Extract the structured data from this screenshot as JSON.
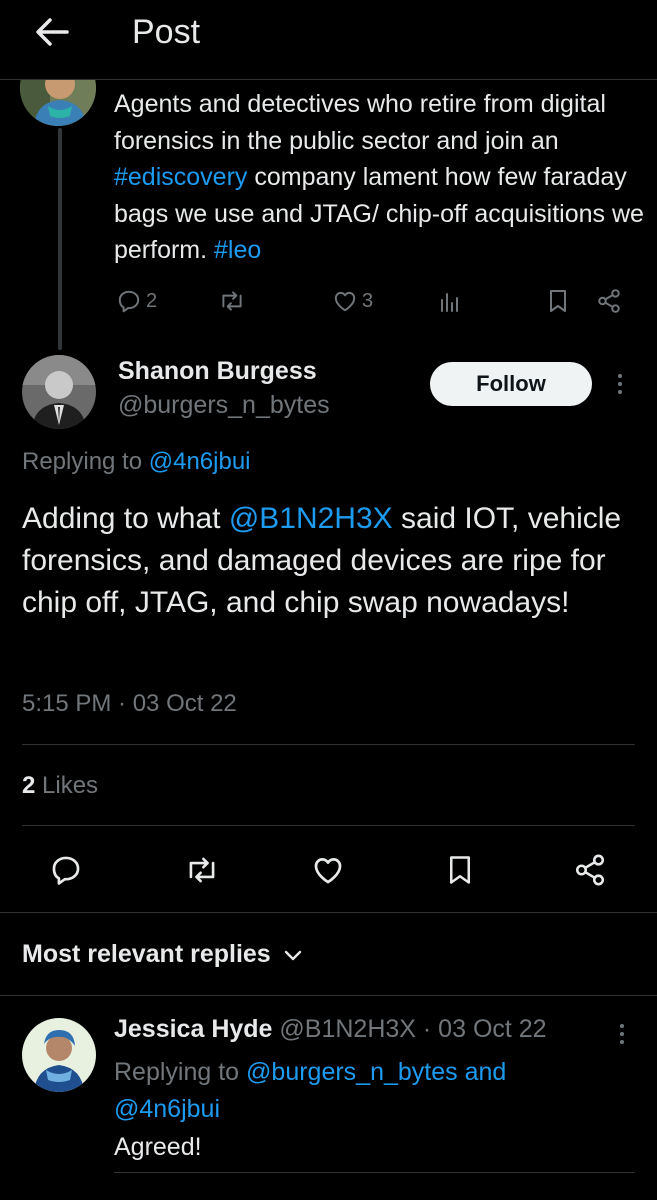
{
  "header": {
    "back_icon": "arrow-left-icon",
    "title": "Post"
  },
  "parent_post": {
    "avatar_icon": "avatar-image",
    "text_parts": {
      "p1": "Agents and detectives who retire from digital forensics in the public sector and join an ",
      "hashtag1": "#ediscovery",
      "p2": " company lament how few faraday bags we use and JTAG/ chip-off acquisitions we perform. ",
      "hashtag2": "#leo"
    },
    "actions": {
      "reply_count": "2",
      "repost_count": "",
      "like_count": "3"
    }
  },
  "main_post": {
    "author_name": "Shanon Burgess",
    "author_handle": "@burgers_n_bytes",
    "follow_label": "Follow",
    "replying_prefix": "Replying to ",
    "replying_to": "@4n6jbui",
    "text_parts": {
      "p1": "Adding to what ",
      "mention": "@B1N2H3X",
      "p2": " said IOT, vehicle forensics, and damaged devices are ripe for chip off, JTAG, and chip swap nowadays!"
    },
    "timestamp": "5:15 PM · 03 Oct 22",
    "likes_count": "2",
    "likes_label": " Likes"
  },
  "replies": {
    "sort_label": "Most relevant replies",
    "items": [
      {
        "author_name": "Jessica Hyde",
        "author_handle": "@B1N2H3X",
        "date": " · 03 Oct 22",
        "replying_prefix": "Replying to ",
        "replying_to_1": "@burgers_n_bytes",
        "replying_and": " and ",
        "replying_to_2": "@4n6jbui",
        "text": "Agreed!"
      }
    ]
  },
  "colors": {
    "background": "#000000",
    "text": "#e7e9ea",
    "secondary": "#71767b",
    "accent": "#1d9bf0",
    "divider": "#2f3336"
  }
}
